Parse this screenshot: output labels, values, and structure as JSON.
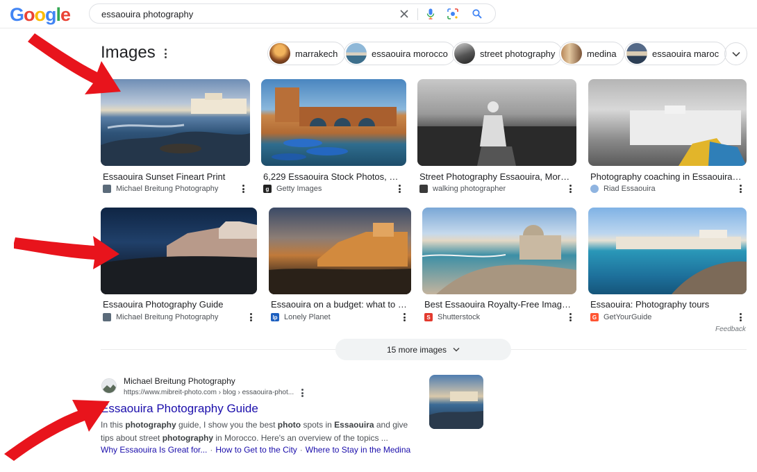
{
  "logo": {
    "letters": [
      "G",
      "o",
      "o",
      "g",
      "l",
      "e"
    ],
    "colors": [
      "#4285f4",
      "#ea4335",
      "#fbbc05",
      "#4285f4",
      "#34a853",
      "#ea4335"
    ]
  },
  "search": {
    "query": "essaouira photography"
  },
  "images_section": {
    "title": "Images",
    "chips": [
      {
        "label": "marrakech"
      },
      {
        "label": "essaouira morocco"
      },
      {
        "label": "street photography"
      },
      {
        "label": "medina"
      },
      {
        "label": "essaouira maroc"
      }
    ],
    "cards": [
      {
        "title": "Essaouira Sunset Fineart Print",
        "source": "Michael Breitung Photography"
      },
      {
        "title": "6,229 Essaouira Stock Photos, Hig...",
        "source": "Getty Images"
      },
      {
        "title": "Street Photography Essaouira, Morocc...",
        "source": "walking photographer"
      },
      {
        "title": "Photography coaching in Essaouira in t...",
        "source": "Riad Essaouira"
      },
      {
        "title": "Essaouira Photography Guide",
        "source": "Michael Breitung Photography"
      },
      {
        "title": "Essaouira on a budget: what to see...",
        "source": "Lonely Planet"
      },
      {
        "title": "Best Essaouira Royalty-Free Images, ...",
        "source": "Shutterstock"
      },
      {
        "title": "Essaouira: Photography tours",
        "source": "GetYourGuide"
      }
    ],
    "feedback": "Feedback",
    "more_images": "15 more images"
  },
  "result": {
    "site_name": "Michael Breitung Photography",
    "url": "https://www.mibreit-photo.com › blog › essaouira-phot...",
    "title": "Essaouira Photography Guide",
    "snippet_parts": [
      "In this ",
      "photography",
      " guide, I show you the best ",
      "photo",
      " spots in ",
      "Essaouira",
      " and give",
      "tips about street ",
      "photography",
      " in Morocco. Here's an overview of the topics ..."
    ],
    "sitelinks": [
      "Why Essaouira Is Great for...",
      "How to Get to the City",
      "Where to Stay in the Medina"
    ]
  },
  "colors": {
    "link": "#1a0dab",
    "annotation_arrow": "#e8141c"
  }
}
